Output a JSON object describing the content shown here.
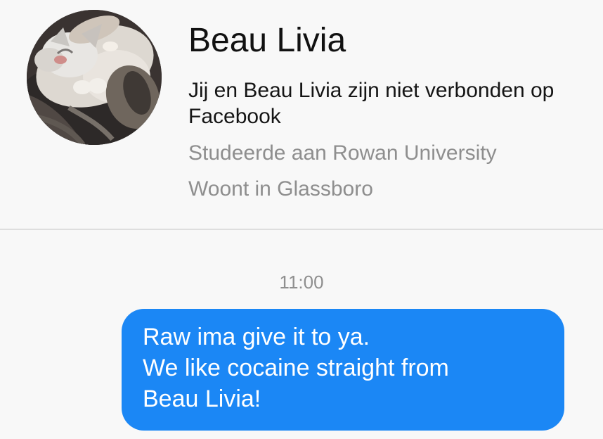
{
  "profile": {
    "name": "Beau Livia",
    "connection_note": "Jij en Beau Livia zijn niet verbonden op Facebook",
    "education": "Studeerde aan Rowan University",
    "location": "Woont in Glassboro",
    "avatar_description_icon": "cat-photo"
  },
  "conversation": {
    "timestamp": "11:00",
    "messages": [
      {
        "sender": "self",
        "lines": [
          "Raw ima give it to ya.",
          "We like cocaine straight from",
          "Beau Livia!"
        ]
      }
    ]
  },
  "colors": {
    "background": "#f8f8f8",
    "sent_bubble": "#1b87f5",
    "secondary_text": "#8e8e8e",
    "primary_text": "#111111",
    "divider": "#dedede"
  }
}
